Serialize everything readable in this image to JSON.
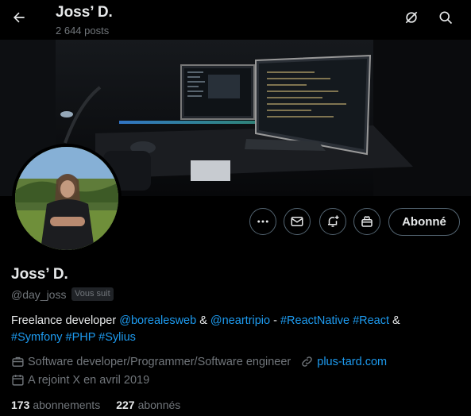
{
  "header": {
    "name": "Joss’ D.",
    "posts": "2 644 posts"
  },
  "profile": {
    "display_name": "Joss’ D.",
    "handle": "@day_joss",
    "follows_you": "Vous suit",
    "follow_button": "Abonné",
    "bio": {
      "t1": "Freelance developer ",
      "m1": "@borealesweb",
      "t2": " & ",
      "m2": "@neartripio",
      "t3": " - ",
      "h1": "#ReactNative",
      "t4": " ",
      "h2": "#React",
      "t5": " & ",
      "h3": "#Symfony",
      "t6": " ",
      "h4": "#PHP",
      "t7": " ",
      "h5": "#Sylius"
    },
    "job": "Software developer/Programmer/Software engineer",
    "website": "plus-tard.com",
    "joined": "A rejoint X en avril 2019",
    "following_count": "173",
    "following_label": "abonnements",
    "followers_count": "227",
    "followers_label": "abonnés"
  },
  "colors": {
    "background": "#000000",
    "text": "#e7e9ea",
    "muted": "#71767b",
    "accent": "#1d9bf0",
    "border": "#536471"
  },
  "icons": [
    "back-arrow-icon",
    "grok-icon",
    "search-icon",
    "more-icon",
    "mail-icon",
    "notification-plus-icon",
    "subscribe-icon",
    "briefcase-icon",
    "link-icon",
    "calendar-icon"
  ]
}
